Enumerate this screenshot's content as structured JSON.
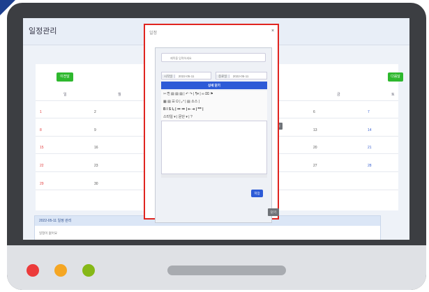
{
  "app": {
    "title": "일정관리"
  },
  "calendar": {
    "prev_label": "이전달",
    "next_label": "다음달",
    "weekday_sun": "일",
    "weekday_mon": "월",
    "weekday_fri": "금",
    "weekday_sat": "토",
    "days": {
      "r1": [
        "1",
        "2",
        "6",
        "7"
      ],
      "r2": [
        "8",
        "9",
        "13",
        "14"
      ],
      "r3": [
        "15",
        "16",
        "20",
        "21"
      ],
      "r4": [
        "22",
        "23",
        "27",
        "28"
      ],
      "r5": [
        "29",
        "30"
      ]
    },
    "tag_label": "내일"
  },
  "panel": {
    "title": "2022-05-11 일정 관리",
    "body": "일정이 없어요"
  },
  "modal": {
    "title": "일정",
    "close": "×",
    "subject_placeholder": "제목을 입력하세요",
    "start_label": "시작일",
    "start_value": "2022-05-11",
    "end_label": "종료일",
    "end_value": "2022-05-11",
    "collapse_label": "상세 닫기",
    "toolbar_row1": "✂  ⎘  ▤  ▤  ▤  |  ↶  ↷  |  ¶▾  |  ∞  ⌧  ⚑",
    "toolbar_row2": "▦  ▤  ☰  Ω  |  ⤢  |  ▤ 소스  |",
    "toolbar_row3": "B  I  S  Iₓ  |  ≔  ≔  |  ⇤  ⇥  |  ❞❞  |",
    "toolbar_row4": "스타일      ▾  |  문단      ▾  |  ?",
    "save_label": "저장",
    "footer_label": "닫기"
  }
}
